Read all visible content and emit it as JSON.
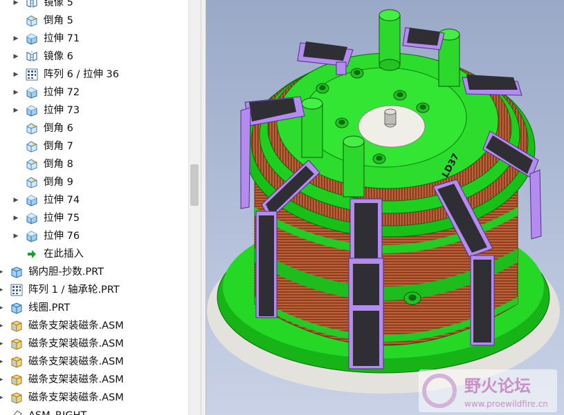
{
  "tree": {
    "items": [
      {
        "label": "镜像 5",
        "icon": "mirror-icon",
        "expand": true,
        "level": 1
      },
      {
        "label": "倒角 5",
        "icon": "chamfer-icon",
        "expand": false,
        "level": 1
      },
      {
        "label": "拉伸 71",
        "icon": "extrude-icon",
        "expand": true,
        "level": 1
      },
      {
        "label": "镜像 6",
        "icon": "mirror-icon",
        "expand": true,
        "level": 1
      },
      {
        "label": "阵列 6 / 拉伸 36",
        "icon": "pattern-icon",
        "expand": true,
        "level": 1
      },
      {
        "label": "拉伸 72",
        "icon": "extrude-icon",
        "expand": true,
        "level": 1
      },
      {
        "label": "拉伸 73",
        "icon": "extrude-icon",
        "expand": true,
        "level": 1
      },
      {
        "label": "倒角 6",
        "icon": "chamfer-icon",
        "expand": false,
        "level": 1
      },
      {
        "label": "倒角 7",
        "icon": "chamfer-icon",
        "expand": false,
        "level": 1
      },
      {
        "label": "倒角 8",
        "icon": "chamfer-icon",
        "expand": false,
        "level": 1
      },
      {
        "label": "倒角 9",
        "icon": "chamfer-icon",
        "expand": false,
        "level": 1
      },
      {
        "label": "拉伸 74",
        "icon": "extrude-icon",
        "expand": true,
        "level": 1
      },
      {
        "label": "拉伸 75",
        "icon": "extrude-icon",
        "expand": true,
        "level": 1
      },
      {
        "label": "拉伸 76",
        "icon": "extrude-icon",
        "expand": true,
        "level": 1
      },
      {
        "label": "在此插入",
        "icon": "insert-here-icon",
        "expand": false,
        "level": 1
      },
      {
        "label": "锅内胆-抄数.PRT",
        "icon": "part-icon",
        "expand": true,
        "level": 0
      },
      {
        "label": "阵列 1 / 轴承轮.PRT",
        "icon": "pattern-icon",
        "expand": true,
        "level": 0
      },
      {
        "label": "线圈.PRT",
        "icon": "part-icon",
        "expand": true,
        "level": 0
      },
      {
        "label": "磁条支架装磁条.ASM",
        "icon": "assembly-icon",
        "expand": true,
        "level": 0
      },
      {
        "label": "磁条支架装磁条.ASM",
        "icon": "assembly-icon",
        "expand": true,
        "level": 0
      },
      {
        "label": "磁条支架装磁条.ASM",
        "icon": "assembly-icon",
        "expand": true,
        "level": 0
      },
      {
        "label": "磁条支架装磁条.ASM",
        "icon": "assembly-icon",
        "expand": true,
        "level": 0
      },
      {
        "label": "磁条支架装磁条.ASM",
        "icon": "assembly-icon",
        "expand": true,
        "level": 0
      },
      {
        "label": "ASM_RIGHT",
        "icon": "datum-plane-icon",
        "expand": false,
        "level": 0
      }
    ]
  },
  "model": {
    "label_on_part": "LD37"
  },
  "watermark": {
    "title": "野火论坛",
    "url": "www.proewildfire.cn"
  },
  "colors": {
    "part_green": "#22e022",
    "bracket_purple": "#b48cf0",
    "magnet_dark": "#2e2e34",
    "coil_copper": "#a8522f",
    "viewport_bg": "#aebbd6"
  }
}
